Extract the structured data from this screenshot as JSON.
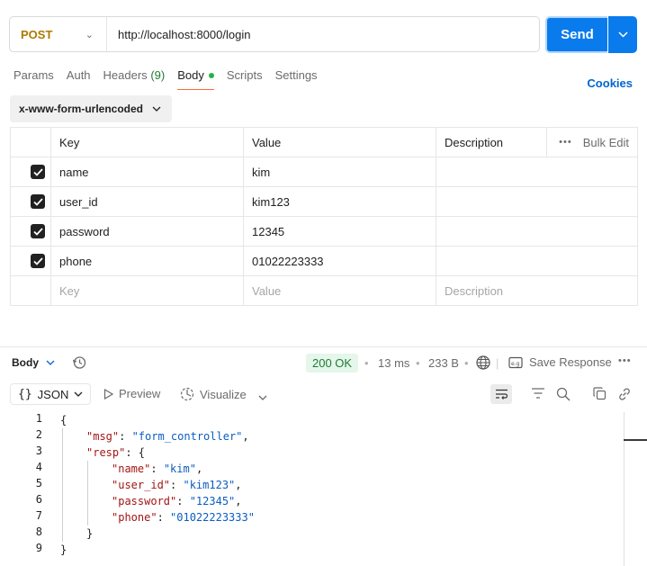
{
  "request": {
    "method": "POST",
    "url": "http://localhost:8000/login",
    "send_label": "Send"
  },
  "tabs": [
    {
      "label": "Params",
      "active": false
    },
    {
      "label": "Auth",
      "active": false
    },
    {
      "label": "Headers",
      "count": "(9)",
      "active": false
    },
    {
      "label": "Body",
      "active": true
    },
    {
      "label": "Scripts",
      "active": false
    },
    {
      "label": "Settings",
      "active": false
    }
  ],
  "cookies_label": "Cookies",
  "body_type": "x-www-form-urlencoded",
  "table": {
    "headers": {
      "key": "Key",
      "value": "Value",
      "description": "Description",
      "bulk": "Bulk Edit"
    },
    "rows": [
      {
        "key": "name",
        "value": "kim",
        "checked": true
      },
      {
        "key": "user_id",
        "value": "kim123",
        "checked": true
      },
      {
        "key": "password",
        "value": "12345",
        "checked": true
      },
      {
        "key": "phone",
        "value": "01022223333",
        "checked": true
      }
    ],
    "placeholders": {
      "key": "Key",
      "value": "Value",
      "description": "Description"
    }
  },
  "response": {
    "body_label": "Body",
    "status": "200 OK",
    "time": "13 ms",
    "size": "233 B",
    "save_label": "Save Response",
    "format": "JSON",
    "preview_label": "Preview",
    "visualize_label": "Visualize",
    "line_numbers": [
      "1",
      "2",
      "3",
      "4",
      "5",
      "6",
      "7",
      "8",
      "9"
    ],
    "code": {
      "open": "{",
      "msg_key": "\"msg\"",
      "msg_val": "\"form_controller\"",
      "resp_key": "\"resp\"",
      "name_key": "\"name\"",
      "name_val": "\"kim\"",
      "uid_key": "\"user_id\"",
      "uid_val": "\"kim123\"",
      "pw_key": "\"password\"",
      "pw_val": "\"12345\"",
      "phone_key": "\"phone\"",
      "phone_val": "\"01022223333\"",
      "close_inner": "}",
      "close": "}"
    }
  },
  "colors": {
    "accent": "#097bed",
    "method": "#ad7a03",
    "status_ok": "#1e7d34",
    "json_key": "#a31515",
    "json_string": "#0b5dc1",
    "tab_underline": "#ff6c37"
  }
}
